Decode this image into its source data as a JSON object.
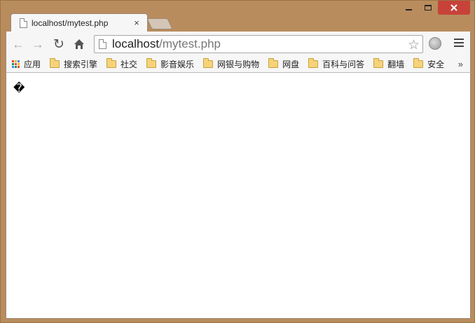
{
  "tab": {
    "title": "localhost/mytest.php",
    "close": "×"
  },
  "address_bar": {
    "host": "localhost",
    "path": "/mytest.php"
  },
  "bookmarks": {
    "apps_label": "应用",
    "items": [
      "搜索引擎",
      "社交",
      "影音娱乐",
      "网银与购物",
      "网盘",
      "百科与问答",
      "翻墙",
      "安全"
    ],
    "more": "»"
  },
  "page": {
    "body_text": "�"
  },
  "colors": {
    "frame": "#b98c5e",
    "close_button": "#c7433a",
    "toolbar": "#f6f6f6",
    "folder": "#f6d37a"
  },
  "icons": {
    "back": "arrow-left",
    "forward": "arrow-right",
    "reload": "reload",
    "home": "home",
    "star": "star",
    "menu": "hamburger"
  }
}
